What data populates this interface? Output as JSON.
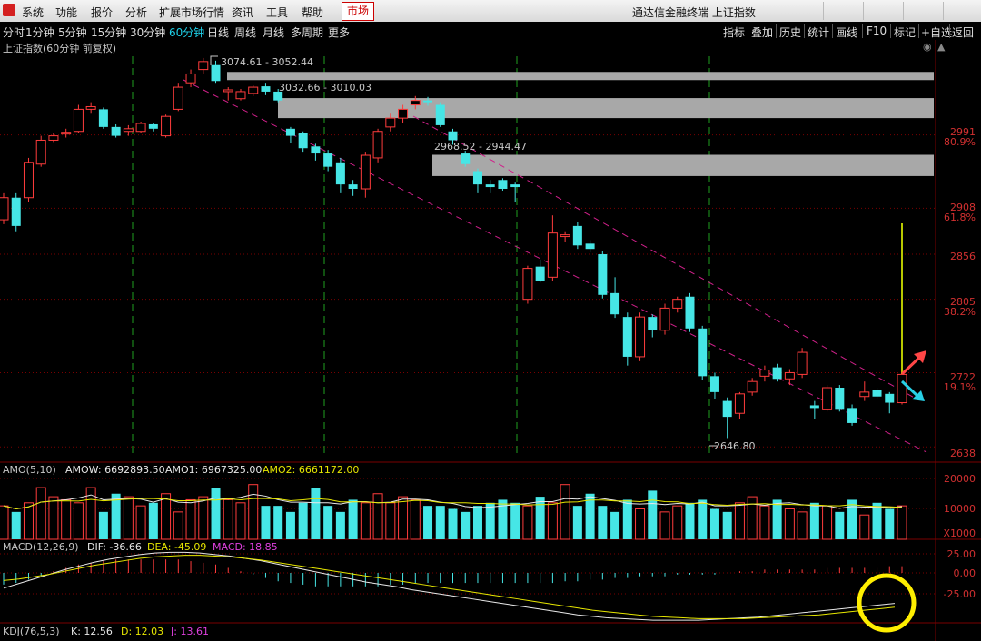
{
  "menu": {
    "items": [
      "系统",
      "功能",
      "报价",
      "分析",
      "扩展市场行情",
      "资讯",
      "工具",
      "帮助"
    ],
    "market": "市场",
    "app_title": "通达信金融终端  上证指数"
  },
  "toolbar": {
    "timeframes": [
      "分时",
      "1分钟",
      "5分钟",
      "15分钟",
      "30分钟",
      "60分钟",
      "日线",
      "周线",
      "月线",
      "多周期",
      "更多"
    ],
    "active": "60分钟",
    "right_buttons": [
      "指标",
      "叠加",
      "历史",
      "统计",
      "画线",
      "F10",
      "标记",
      "+自选",
      "返回"
    ]
  },
  "chart_title": "上证指数(60分钟 前复权)",
  "price_axis": {
    "labels": [
      "2991",
      "2908",
      "2856",
      "2805",
      "2722",
      "2638"
    ],
    "percent_labels": [
      "80.9%",
      "61.8%",
      "38.2%",
      "19.1%"
    ]
  },
  "annotations": {
    "gap1": "3074.61 - 3052.44",
    "gap2": "3032.66 - 3010.03",
    "gap3": "2968.52 - 2944.47",
    "low": "2646.80",
    "high": "3074.61"
  },
  "amo": {
    "label": "AMO(5,10)",
    "amow": "AMOW: 6692893.50",
    "amo1": "AMO1: 6967325.00",
    "amo2": "AMO2: 6661172.00",
    "axis": [
      "20000",
      "10000",
      "X1000"
    ]
  },
  "macd": {
    "label": "MACD(12,26,9)",
    "dif": "DIF: -36.66",
    "dea": "DEA: -45.09",
    "macd": "MACD: 18.85",
    "axis": [
      "25.00",
      "0.00",
      "-25.00"
    ]
  },
  "kdj": {
    "label": "KDJ(76,5,3)",
    "k": "K: 12.56",
    "d": "D: 12.03",
    "j": "J: 13.61"
  },
  "colors": {
    "up": "#ff3c3c",
    "down": "#46e6e6",
    "grid": "#7a0000",
    "dif": "#e8e8e8",
    "dea": "#e6e600"
  },
  "candles": [
    [
      2895,
      2920,
      2890,
      2925
    ],
    [
      2920,
      2888,
      2882,
      2925
    ],
    [
      2920,
      2960,
      2915,
      2965
    ],
    [
      2958,
      2985,
      2955,
      2990
    ],
    [
      2985,
      2990,
      2983,
      2993
    ],
    [
      2992,
      2994,
      2988,
      2998
    ],
    [
      2995,
      3020,
      2993,
      3025
    ],
    [
      3020,
      3023,
      3015,
      3028
    ],
    [
      3020,
      3000,
      2998,
      3022
    ],
    [
      3000,
      2990,
      2988,
      3003
    ],
    [
      2995,
      2998,
      2990,
      3002
    ],
    [
      2995,
      3004,
      2993,
      3006
    ],
    [
      3003,
      2998,
      2995,
      3005
    ],
    [
      2990,
      3012,
      2988,
      3014
    ],
    [
      3020,
      3045,
      3018,
      3050
    ],
    [
      3050,
      3060,
      3045,
      3065
    ],
    [
      3065,
      3074,
      3060,
      3078
    ],
    [
      3070,
      3052,
      3050,
      3075
    ],
    [
      3040,
      3042,
      3030,
      3045
    ],
    [
      3032,
      3040,
      3030,
      3043
    ],
    [
      3038,
      3045,
      3035,
      3047
    ],
    [
      3046,
      3040,
      3036,
      3050
    ],
    [
      3040,
      3030,
      3028,
      3043
    ],
    [
      2998,
      2990,
      2982,
      3000
    ],
    [
      2993,
      2976,
      2972,
      2995
    ],
    [
      2978,
      2970,
      2962,
      2981
    ],
    [
      2970,
      2955,
      2950,
      2974
    ],
    [
      2960,
      2935,
      2925,
      2965
    ],
    [
      2935,
      2930,
      2922,
      2940
    ],
    [
      2930,
      2968,
      2920,
      2972
    ],
    [
      2965,
      2995,
      2960,
      2998
    ],
    [
      3000,
      3010,
      2995,
      3015
    ],
    [
      3010,
      3020,
      3005,
      3025
    ],
    [
      3025,
      3030,
      3020,
      3035
    ],
    [
      3030,
      3028,
      3024,
      3034
    ],
    [
      3025,
      3002,
      3000,
      3028
    ],
    [
      2995,
      2985,
      2980,
      2998
    ],
    [
      2970,
      2958,
      2955,
      2973
    ],
    [
      2950,
      2935,
      2925,
      2953
    ],
    [
      2935,
      2932,
      2925,
      2940
    ],
    [
      2940,
      2930,
      2928,
      2942
    ],
    [
      2935,
      2932,
      2915,
      2937
    ],
    [
      2805,
      2840,
      2800,
      2843
    ],
    [
      2842,
      2826,
      2824,
      2850
    ],
    [
      2830,
      2880,
      2826,
      2900
    ],
    [
      2876,
      2878,
      2870,
      2882
    ],
    [
      2888,
      2866,
      2862,
      2892
    ],
    [
      2868,
      2862,
      2858,
      2872
    ],
    [
      2856,
      2810,
      2806,
      2860
    ],
    [
      2812,
      2788,
      2784,
      2830
    ],
    [
      2785,
      2740,
      2730,
      2790
    ],
    [
      2740,
      2785,
      2735,
      2790
    ],
    [
      2785,
      2770,
      2762,
      2788
    ],
    [
      2770,
      2795,
      2765,
      2800
    ],
    [
      2795,
      2805,
      2790,
      2808
    ],
    [
      2808,
      2772,
      2768,
      2812
    ],
    [
      2772,
      2718,
      2714,
      2775
    ],
    [
      2718,
      2700,
      2692,
      2722
    ],
    [
      2690,
      2672,
      2648,
      2694
    ],
    [
      2676,
      2698,
      2670,
      2700
    ],
    [
      2700,
      2712,
      2696,
      2716
    ],
    [
      2718,
      2725,
      2712,
      2730
    ],
    [
      2728,
      2715,
      2712,
      2732
    ],
    [
      2715,
      2722,
      2708,
      2726
    ],
    [
      2720,
      2745,
      2716,
      2750
    ],
    [
      2685,
      2682,
      2670,
      2690
    ],
    [
      2680,
      2705,
      2678,
      2708
    ],
    [
      2705,
      2680,
      2678,
      2708
    ],
    [
      2682,
      2665,
      2662,
      2686
    ],
    [
      2695,
      2700,
      2690,
      2712
    ],
    [
      2702,
      2695,
      2692,
      2705
    ],
    [
      2698,
      2688,
      2676,
      2700
    ],
    [
      2688,
      2720,
      2686,
      2722
    ]
  ],
  "amo_bars": [
    11,
    9,
    12,
    17,
    14,
    13,
    12,
    17,
    9,
    15,
    14,
    11,
    12,
    15,
    9,
    13,
    14,
    17,
    13,
    12,
    18,
    11,
    11,
    9,
    12,
    17,
    11,
    9,
    13,
    12,
    15,
    12,
    14,
    13,
    11,
    11,
    10,
    9,
    11,
    12,
    13,
    12,
    11,
    14,
    12,
    18,
    11,
    15,
    11,
    9,
    13,
    10,
    16,
    9,
    11,
    12,
    13,
    10,
    9,
    12,
    14,
    11,
    13,
    10,
    9,
    12,
    11,
    9,
    13,
    8,
    12,
    10,
    11
  ],
  "macd_hist": [
    -7,
    -6,
    -4,
    -2,
    1,
    3,
    5,
    6,
    7,
    8,
    8,
    8,
    8,
    8,
    8,
    7,
    6,
    5,
    3,
    1,
    -1,
    -3,
    -5,
    -6,
    -7,
    -8,
    -8,
    -8,
    -8,
    -8,
    -8,
    -7,
    -7,
    -6,
    -6,
    -6,
    -6,
    -6,
    -6,
    -6,
    -6,
    -6,
    -6,
    -6,
    -6,
    -5,
    -5,
    -4,
    -4,
    -3,
    -3,
    -2,
    -2,
    -2,
    -1,
    -1,
    -1,
    -1,
    0,
    1,
    1,
    2,
    2,
    2,
    2,
    2,
    3,
    3,
    3,
    3,
    3,
    4,
    4
  ],
  "dif_line": [
    -20,
    -14,
    -8,
    -2,
    4,
    9,
    14,
    18,
    21,
    24,
    26,
    27,
    27,
    26,
    24,
    22,
    19,
    16,
    12,
    8,
    4,
    0,
    -4,
    -8,
    -12,
    -15,
    -18,
    -22,
    -25,
    -28,
    -31,
    -34,
    -37,
    -40,
    -43,
    -46,
    -49,
    -52,
    -55,
    -57,
    -59,
    -60,
    -61,
    -62,
    -62,
    -62,
    -62,
    -61,
    -60,
    -59,
    -58,
    -56,
    -54,
    -52,
    -50,
    -48,
    -46,
    -44,
    -42,
    -40
  ],
  "dea_line": [
    -10,
    -8,
    -5,
    -2,
    2,
    6,
    10,
    13,
    16,
    19,
    21,
    22,
    23,
    23,
    22,
    21,
    19,
    17,
    14,
    11,
    8,
    5,
    2,
    -1,
    -4,
    -7,
    -10,
    -13,
    -16,
    -19,
    -22,
    -25,
    -28,
    -31,
    -34,
    -37,
    -40,
    -43,
    -46,
    -49,
    -51,
    -53,
    -55,
    -57,
    -58,
    -59,
    -60,
    -60,
    -60,
    -60,
    -59,
    -58,
    -57,
    -56,
    -55,
    -53,
    -51,
    -49,
    -47,
    -45
  ]
}
